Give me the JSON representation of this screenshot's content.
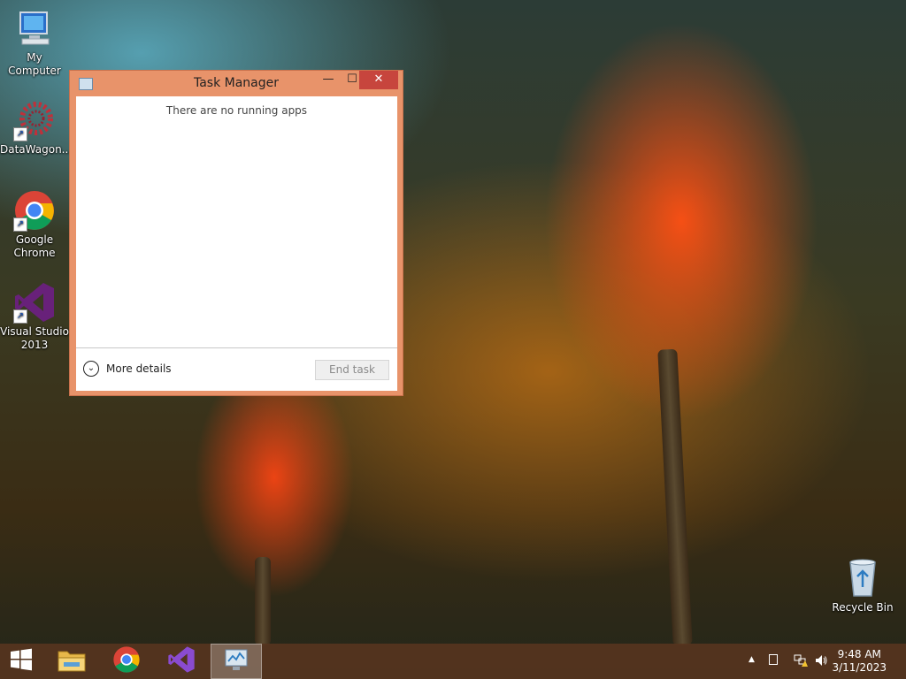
{
  "desktop": {
    "icons": [
      {
        "label": "My Computer"
      },
      {
        "label": "DataWagon..."
      },
      {
        "label": "Google Chrome"
      },
      {
        "label": "Visual Studio 2013"
      },
      {
        "label": "Recycle Bin"
      }
    ]
  },
  "window": {
    "title": "Task Manager",
    "minimize_glyph": "—",
    "maximize_glyph": "☐",
    "close_glyph": "✕",
    "empty_message": "There are no running apps",
    "more_details_label": "More details",
    "end_task_label": "End task"
  },
  "taskbar": {
    "items": [
      {
        "icon": "windows-start-icon"
      },
      {
        "icon": "file-explorer-icon"
      },
      {
        "icon": "chrome-icon"
      },
      {
        "icon": "visual-studio-icon"
      },
      {
        "icon": "task-manager-icon",
        "active": true
      }
    ],
    "tray": {
      "time": "9:48 AM",
      "date": "3/11/2023",
      "show_hidden_glyph": "▲"
    }
  },
  "colors": {
    "window_frame": "#e8936a",
    "close_button": "#c7453d",
    "taskbar": "#56341e"
  }
}
